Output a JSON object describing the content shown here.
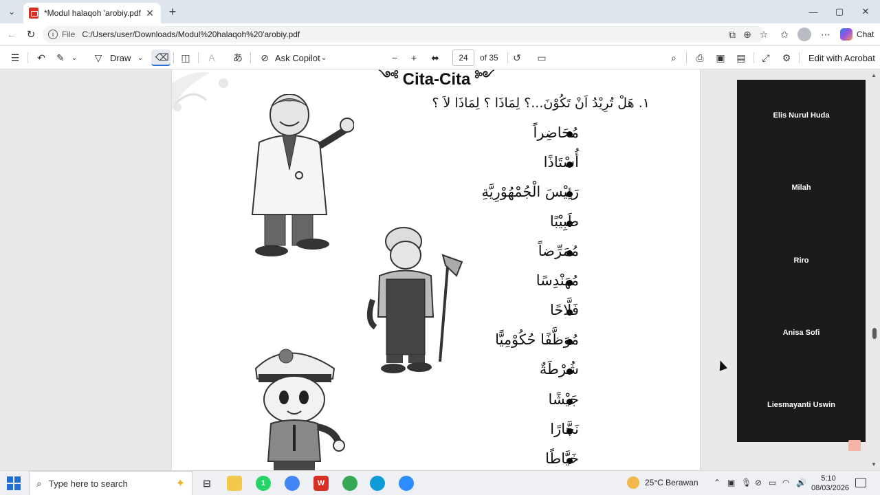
{
  "browser": {
    "tab": {
      "title": "*Modul halaqoh 'arobiy.pdf",
      "close": "✕"
    },
    "new_tab": "+",
    "window": {
      "minimize": "—",
      "maximize": "▢",
      "close": "✕"
    },
    "address": {
      "scheme": "File",
      "url": "C:/Users/user/Downloads/Modul%20halaqoh%20'arobiy.pdf"
    },
    "chat_label": "Chat"
  },
  "pdf_toolbar": {
    "draw_label": "Draw",
    "ask_copilot_label": "Ask Copilot",
    "current_page": "24",
    "page_count": "of 35",
    "edit_acrobat_label": "Edit with Acrobat"
  },
  "document": {
    "heading": "Cita-Cita",
    "heading_ornament_left": "༺",
    "heading_ornament_right": "༻",
    "question": "١.   هَلْ تُرِيْدُ اَنْ تَكُوْنَ...؟ لِمَاذَا ؟ لِمَاذَا لاَ ؟",
    "items": [
      "مُحَاضِراً",
      "أُسْتَاذًا",
      "رَئِيْسَ الْجُمْهُوْرِيَّةِ",
      "طَبِيْبًا",
      "مُمَرِّضاً",
      "مُهَنْدِسًا",
      "فَلَّاحًا",
      "مُوَظَّفًا حُكُوْمِيًّا",
      "شُرْطَةٌ",
      "جَيْشًا",
      "نَجَّارًا",
      "خَيَّاطًا"
    ]
  },
  "participants": [
    "Elis Nurul Huda",
    "Milah",
    "Riro",
    "Anisa Sofi",
    "Liesmayanti Uswin"
  ],
  "taskbar": {
    "search_placeholder": "Type here to search",
    "weather": "25°C  Berawan",
    "time": "5:10",
    "date": "08/03/2026",
    "whatsapp_badge": "1"
  }
}
